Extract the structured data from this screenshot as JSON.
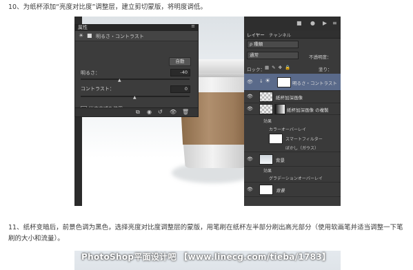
{
  "step10": "10、为纸杯添加“亮度对比度”调整层，建立剪切蒙版，将明度调低。",
  "step11": "11、纸杯变暗后，前景色调为黑色，选择亮度对比度调整层的蒙版，用笔刷在纸杯左半部分刷出高光部分（使用软画笔并适当调整一下笔刷的大小和流量）。",
  "watermark": "PhotoShop平面设计吧 【www.linecg.com/tieba/1783】",
  "properties": {
    "tab": "属性",
    "close": "≡",
    "adjustment_label": "明るさ・コントラスト",
    "auto_button": "自動",
    "brightness_label": "明るさ：",
    "brightness_value": "-40",
    "contrast_label": "コントラスト：",
    "contrast_value": "0",
    "legacy_label": "従来方式を使用"
  },
  "layers": {
    "tab1": "レイヤー",
    "tab2": "チャンネル",
    "filter_kind": "ρ 種類",
    "blend_mode": "通常",
    "opacity_label": "不透明度：",
    "lock_label": "ロック：",
    "fill_label": "塗り：",
    "items": [
      {
        "name": "明るさ・コントラスト"
      },
      {
        "name": "紙杯加深画像"
      },
      {
        "name": "紙杯加深画像 の複製"
      },
      {
        "name": "背景"
      },
      {
        "name": "背景"
      }
    ],
    "effects_label": "効果",
    "fx1": "カラーオーバーレイ",
    "fx_smart": "スマートフィルター",
    "fx_blur": "ぼかし（ガウス）",
    "fx_gradient": "グラデーションオーバーレイ"
  },
  "colors": {
    "panel_bg": "#3c3c3c",
    "selected_layer": "#5a6a8a"
  }
}
